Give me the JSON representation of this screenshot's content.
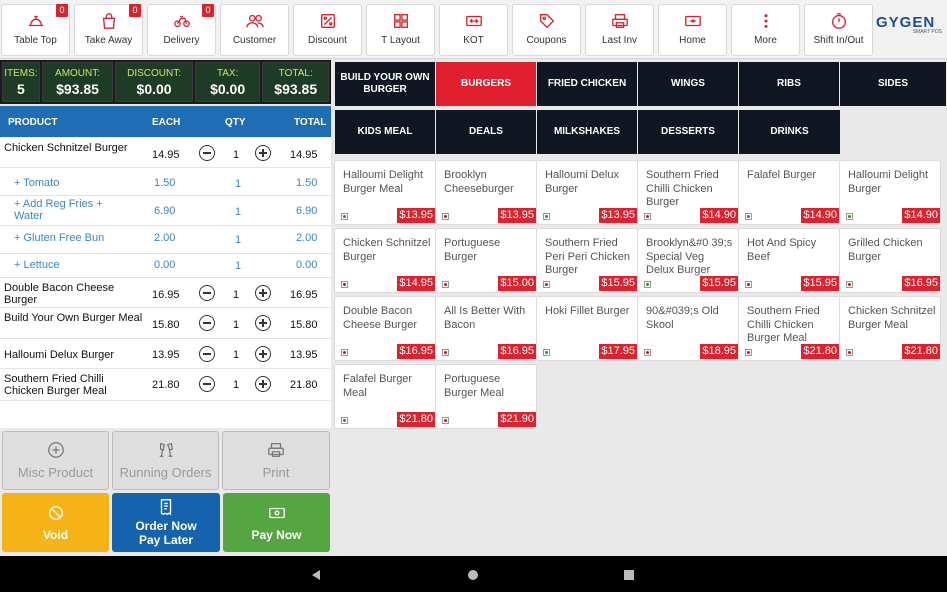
{
  "toolbar": {
    "buttons": [
      {
        "label": "Table Top",
        "icon": "table-top-icon",
        "badge": "0"
      },
      {
        "label": "Take Away",
        "icon": "bag-icon",
        "badge": "0"
      },
      {
        "label": "Delivery",
        "icon": "bike-icon",
        "badge": "0"
      },
      {
        "label": "Customer",
        "icon": "users-icon"
      },
      {
        "label": "Discount",
        "icon": "percent-icon"
      },
      {
        "label": "T Layout",
        "icon": "grid-icon"
      },
      {
        "label": "KOT",
        "icon": "kot-icon"
      },
      {
        "label": "Coupons",
        "icon": "tag-icon"
      },
      {
        "label": "Last Inv",
        "icon": "printer-icon"
      },
      {
        "label": "Home",
        "icon": "home-icon"
      },
      {
        "label": "More",
        "icon": "more-vertical-icon"
      },
      {
        "label": "Shift In/Out",
        "icon": "stopwatch-icon"
      }
    ],
    "logo": "GYGEN",
    "logo_sub": "SMART POS"
  },
  "totals": {
    "items_label": "ITEMS:",
    "items": "5",
    "amount_label": "AMOUNT:",
    "amount": "$93.85",
    "discount_label": "DISCOUNT:",
    "discount": "$0.00",
    "tax_label": "TAX:",
    "tax": "$0.00",
    "total_label": "TOTAL:",
    "total": "$93.85"
  },
  "order": {
    "headers": {
      "product": "PRODUCT",
      "each": "EACH",
      "qty": "QTY",
      "total": "TOTAL"
    },
    "rows": [
      {
        "name": "Chicken Schnitzel Burger",
        "each": "14.95",
        "qty": "1",
        "total": "14.95"
      },
      {
        "name": "+ Tomato",
        "each": "1.50",
        "qty": "1",
        "total": "1.50"
      },
      {
        "name": "+ Add Reg Fries + Water",
        "each": "6.90",
        "qty": "1",
        "total": "6.90"
      },
      {
        "name": "+ Gluten Free Bun",
        "each": "2.00",
        "qty": "1",
        "total": "2.00"
      },
      {
        "name": "+ Lettuce",
        "each": "0.00",
        "qty": "1",
        "total": "0.00"
      },
      {
        "name": "Double Bacon Cheese Burger",
        "each": "16.95",
        "qty": "1",
        "total": "16.95"
      },
      {
        "name": "Build Your Own Burger Meal",
        "each": "15.80",
        "qty": "1",
        "total": "15.80"
      },
      {
        "name": "Halloumi Delux Burger",
        "each": "13.95",
        "qty": "1",
        "total": "13.95"
      },
      {
        "name": "Southern Fried Chilli Chicken Burger Meal",
        "each": "21.80",
        "qty": "1",
        "total": "21.80"
      }
    ]
  },
  "actions": {
    "misc": "Misc Product",
    "running": "Running Orders",
    "print": "Print",
    "void": "Void",
    "order_now_1": "Order Now",
    "order_now_2": "Pay Later",
    "pay_now": "Pay Now"
  },
  "colors": {
    "accent_red": "#e0202e",
    "void": "#f5b316",
    "order_now": "#1463ac",
    "pay_now": "#55a543",
    "header_blue": "#1f6db3"
  },
  "categories": [
    {
      "label": "BUILD YOUR OWN BURGER",
      "active": false
    },
    {
      "label": "BURGERS",
      "active": true
    },
    {
      "label": "FRIED CHICKEN",
      "active": false
    },
    {
      "label": "WINGS",
      "active": false
    },
    {
      "label": "RIBS",
      "active": false
    },
    {
      "label": "SIDES",
      "active": false
    },
    {
      "label": "KIDS MEAL",
      "active": false
    },
    {
      "label": "DEALS",
      "active": false
    },
    {
      "label": "MILKSHAKES",
      "active": false
    },
    {
      "label": "DESSERTS",
      "active": false
    },
    {
      "label": "DRINKS",
      "active": false
    }
  ],
  "products": [
    {
      "name": "Halloumi Delight Burger Meal",
      "price": "$13.95",
      "veg": true
    },
    {
      "name": "Brooklyn Cheeseburger",
      "price": "$13.95",
      "veg": false
    },
    {
      "name": "Halloumi Delux Burger",
      "price": "$13.95",
      "veg": true
    },
    {
      "name": "Southern Fried Chilli Chicken Burger",
      "price": "$14.90",
      "veg": false
    },
    {
      "name": "Falafel Burger",
      "price": "$14.90",
      "veg": true
    },
    {
      "name": "Halloumi Delight Burger",
      "price": "$14.90",
      "veg": true
    },
    {
      "name": "Chicken Schnitzel Burger",
      "price": "$14.95",
      "veg": false
    },
    {
      "name": "Portuguese Burger",
      "price": "$15.00",
      "veg": false
    },
    {
      "name": "Southern Fried Peri Peri Chicken Burger",
      "price": "$15.95",
      "veg": false
    },
    {
      "name": "Brooklyn&#0 39;s Special Veg Delux Burger",
      "price": "$15.95",
      "veg": true
    },
    {
      "name": "Hot And Spicy Beef",
      "price": "$15.95",
      "veg": false
    },
    {
      "name": "Grilled Chicken Burger",
      "price": "$16.95",
      "veg": false
    },
    {
      "name": "Double Bacon Cheese Burger",
      "price": "$16.95",
      "veg": false
    },
    {
      "name": "All Is Better With Bacon",
      "price": "$16.95",
      "veg": false
    },
    {
      "name": "Hoki Fillet Burger",
      "price": "$17.95",
      "veg": true
    },
    {
      "name": "90&#039;s Old Skool",
      "price": "$18.95",
      "veg": false
    },
    {
      "name": "Southern Fried Chilli Chicken Burger Meal",
      "price": "$21.80",
      "veg": false
    },
    {
      "name": "Chicken Schnitzel Burger Meal",
      "price": "$21.80",
      "veg": false
    },
    {
      "name": "Falafel Burger Meal",
      "price": "$21.80",
      "veg": true
    },
    {
      "name": "Portuguese Burger Meal",
      "price": "$21.90",
      "veg": false
    }
  ]
}
